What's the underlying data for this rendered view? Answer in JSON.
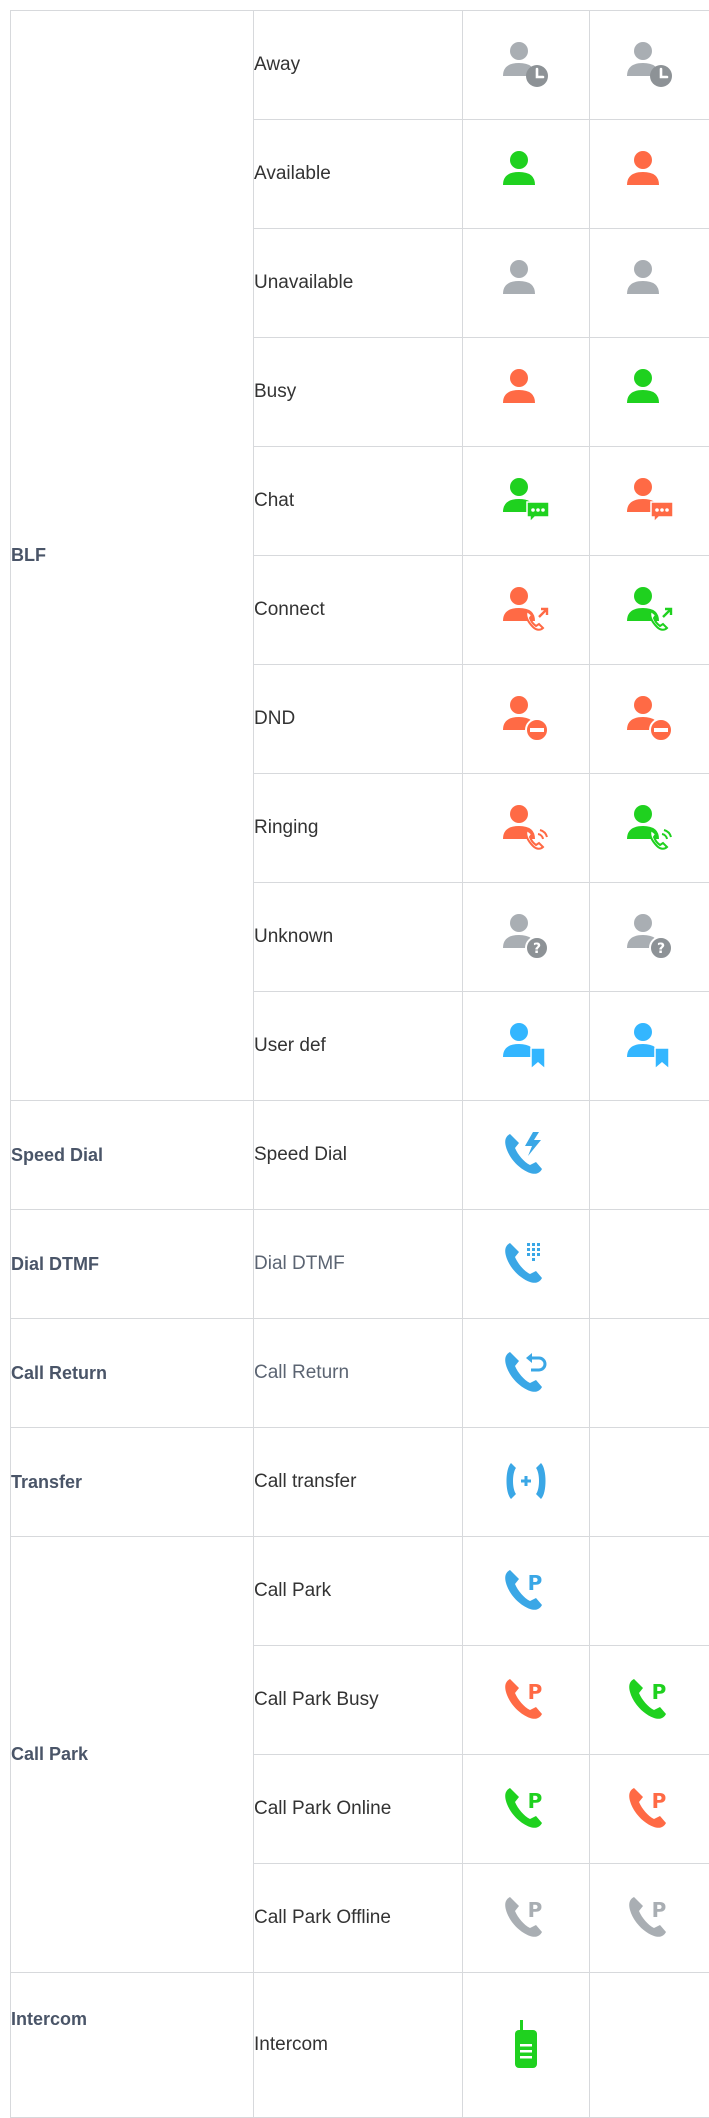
{
  "colors": {
    "green": "#1fd11f",
    "orange": "#ff6a45",
    "gray": "#a9aeb3",
    "blue": "#33b6ff",
    "phone_blue": "#3aa7e6",
    "badge_gray": "#8d9296",
    "border": "#d7d9dc"
  },
  "rows": [
    {
      "category": "",
      "feature": "Away",
      "icon1": {
        "name": "away-icon",
        "person": "gray",
        "badge": "clock"
      },
      "icon2": {
        "name": "away-icon",
        "person": "gray",
        "badge": "clock"
      }
    },
    {
      "category": "",
      "feature": "Available",
      "icon1": {
        "name": "available-icon",
        "person": "green",
        "badge": ""
      },
      "icon2": {
        "name": "available-icon",
        "person": "orange",
        "badge": ""
      }
    },
    {
      "category": "",
      "feature": "Unavailable",
      "icon1": {
        "name": "unavailable-icon",
        "person": "gray",
        "badge": ""
      },
      "icon2": {
        "name": "unavailable-icon",
        "person": "gray",
        "badge": ""
      }
    },
    {
      "category": "",
      "feature": "Busy",
      "icon1": {
        "name": "busy-icon",
        "person": "orange",
        "badge": ""
      },
      "icon2": {
        "name": "busy-icon",
        "person": "green",
        "badge": ""
      }
    },
    {
      "category": "BLF",
      "feature": "Chat",
      "icon1": {
        "name": "chat-icon",
        "person": "green",
        "badge": "chat"
      },
      "icon2": {
        "name": "chat-icon",
        "person": "orange",
        "badge": "chat"
      }
    },
    {
      "category": "",
      "feature": "Connect",
      "icon1": {
        "name": "connect-icon",
        "person": "orange",
        "badge": "connect"
      },
      "icon2": {
        "name": "connect-icon",
        "person": "green",
        "badge": "connect"
      }
    },
    {
      "category": "",
      "feature": "DND",
      "icon1": {
        "name": "dnd-icon",
        "person": "orange",
        "badge": "dnd"
      },
      "icon2": {
        "name": "dnd-icon",
        "person": "orange",
        "badge": "dnd"
      }
    },
    {
      "category": "",
      "feature": "Ringing",
      "icon1": {
        "name": "ringing-icon",
        "person": "orange",
        "badge": "ring"
      },
      "icon2": {
        "name": "ringing-icon",
        "person": "green",
        "badge": "ring"
      }
    },
    {
      "category": "",
      "feature": "Unknown",
      "icon1": {
        "name": "unknown-icon",
        "person": "gray",
        "badge": "question"
      },
      "icon2": {
        "name": "unknown-icon",
        "person": "gray",
        "badge": "question"
      }
    },
    {
      "category": "",
      "feature": "User def",
      "icon1": {
        "name": "user-def-icon",
        "person": "blue",
        "badge": "bookmark"
      },
      "icon2": {
        "name": "user-def-icon",
        "person": "blue",
        "badge": "bookmark"
      }
    },
    {
      "category": "Speed Dial",
      "feature": "Speed Dial",
      "icon1": {
        "name": "speed-dial-icon",
        "phone": "phone_blue",
        "badge": "bolt"
      },
      "icon2": null
    },
    {
      "category": "Dial DTMF",
      "feature": "Dial DTMF",
      "icon1": {
        "name": "dial-dtmf-icon",
        "phone": "phone_blue",
        "badge": "keypad"
      },
      "icon2": null
    },
    {
      "category": "Call Return",
      "feature": "Call Return",
      "icon1": {
        "name": "call-return-icon",
        "phone": "phone_blue",
        "badge": "return"
      },
      "icon2": null
    },
    {
      "category": "Transfer",
      "feature": "Call transfer",
      "icon1": {
        "name": "call-transfer-icon",
        "phone": "phone_blue",
        "badge": "transfer"
      },
      "icon2": null
    },
    {
      "category": "",
      "feature": "Call Park",
      "icon1": {
        "name": "call-park-icon",
        "phone": "phone_blue",
        "badge": "park"
      },
      "icon2": null
    },
    {
      "category": "Call Park",
      "feature": "Call Park Busy",
      "icon1": {
        "name": "call-park-busy-icon",
        "phone": "orange",
        "badge": "park"
      },
      "icon2": {
        "name": "call-park-busy-icon",
        "phone": "green",
        "badge": "park"
      }
    },
    {
      "category": "",
      "feature": "Call Park Online",
      "icon1": {
        "name": "call-park-online-icon",
        "phone": "green",
        "badge": "park"
      },
      "icon2": {
        "name": "call-park-online-icon",
        "phone": "orange",
        "badge": "park"
      }
    },
    {
      "category": "",
      "feature": "Call Park Offline",
      "icon1": {
        "name": "call-park-offline-icon",
        "phone": "gray",
        "badge": "park"
      },
      "icon2": {
        "name": "call-park-offline-icon",
        "phone": "gray",
        "badge": "park"
      }
    },
    {
      "category": "Intercom",
      "feature": "Intercom",
      "icon1": {
        "name": "intercom-icon",
        "device": "green"
      },
      "icon2": null
    }
  ]
}
